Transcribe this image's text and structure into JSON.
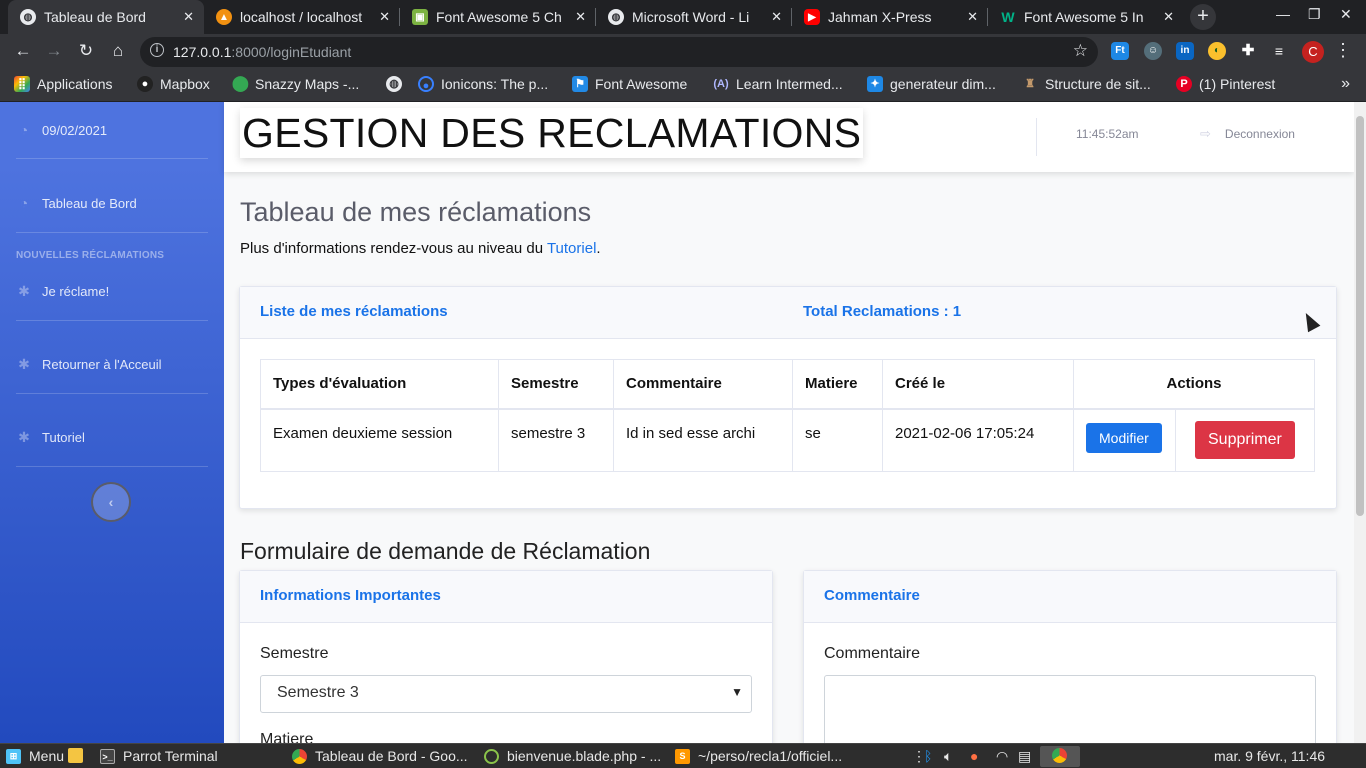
{
  "browser": {
    "tabs": [
      {
        "title": "Tableau de Bord",
        "icon": "globe-icon",
        "color": "#5f6368"
      },
      {
        "title": "localhost / localhost",
        "icon": "phpmyadmin-icon",
        "color": "#f29111"
      },
      {
        "title": "Font Awesome 5 Ch",
        "icon": "font-awesome-icon",
        "color": "#0f9d58"
      },
      {
        "title": "Microsoft Word - Li",
        "icon": "globe-icon",
        "color": "#5f6368"
      },
      {
        "title": "Jahman X-Press",
        "icon": "youtube-icon",
        "color": "#ff0000"
      },
      {
        "title": "Font Awesome 5 In",
        "icon": "w-icon",
        "color": "#00b388"
      }
    ],
    "url": {
      "host": "127.0.0.1",
      "rest": ":8000/loginEtudiant"
    },
    "profile_initial": "C",
    "bookmarks": [
      {
        "label": "Applications",
        "icon": "apps-grid-icon"
      },
      {
        "label": "Mapbox",
        "icon": "mapbox-icon"
      },
      {
        "label": "Snazzy Maps -...",
        "icon": "map-pin-icon"
      },
      {
        "label": "",
        "icon": "globe-icon"
      },
      {
        "label": "Ionicons: The p...",
        "icon": "ionicons-icon"
      },
      {
        "label": "Font Awesome",
        "icon": "flag-icon"
      },
      {
        "label": "Learn Intermed...",
        "icon": "learn-icon"
      },
      {
        "label": "generateur dim...",
        "icon": "generator-icon"
      },
      {
        "label": "Structure de sit...",
        "icon": "structure-icon"
      },
      {
        "label": "(1) Pinterest",
        "icon": "pinterest-icon"
      }
    ]
  },
  "sidebar": {
    "date": "09/02/2021",
    "dashboard": "Tableau de Bord",
    "heading": "NOUVELLES RÉCLAMATIONS",
    "items": [
      {
        "label": "Je réclame!"
      },
      {
        "label": "Retourner à l'Acceuil"
      },
      {
        "label": "Tutoriel"
      }
    ],
    "toggle": "‹"
  },
  "topbar": {
    "brand": "GESTION DES RECLAMATIONS",
    "clock": "11:45:52am",
    "logout": "Deconnexion"
  },
  "main": {
    "title": "Tableau de mes réclamations",
    "subtitle_prefix": "Plus d'informations rendez-vous au niveau du ",
    "subtitle_link": "Tutoriel",
    "subtitle_suffix": ".",
    "list_card": {
      "header_left": "Liste de mes réclamations",
      "header_right": "Total Reclamations : 1",
      "columns": [
        "Types d'évaluation",
        "Semestre",
        "Commentaire",
        "Matiere",
        "Créé le",
        "Actions"
      ],
      "rows": [
        {
          "type": "Examen deuxieme session",
          "semestre": "semestre 3",
          "commentaire": "Id in sed esse archi",
          "matiere": "se",
          "cree_le": "2021-02-06 17:05:24",
          "edit_label": "Modifier",
          "delete_label": "Supprimer"
        }
      ]
    },
    "form_title": "Formulaire de demande de Réclamation",
    "info_card": {
      "header": "Informations Importantes",
      "semestre_label": "Semestre",
      "semestre_value": "Semestre 3",
      "matiere_label": "Matiere"
    },
    "comment_card": {
      "header": "Commentaire",
      "label": "Commentaire",
      "value": ""
    }
  },
  "taskbar": {
    "menu": "Menu",
    "apps": [
      {
        "label": "Parrot Terminal",
        "icon": "terminal-icon"
      },
      {
        "label": "Tableau de Bord - Goo...",
        "icon": "chrome-icon"
      },
      {
        "label": "bienvenue.blade.php - ...",
        "icon": "editor-icon"
      },
      {
        "label": "~/perso/recla1/officiel...",
        "icon": "sublime-icon"
      }
    ],
    "clock": "mar. 9 févr., 11:46"
  },
  "colors": {
    "sidebar_top": "#4e73df",
    "sidebar_bottom": "#224abe",
    "primary": "#1a73e8",
    "danger": "#dc3545"
  }
}
